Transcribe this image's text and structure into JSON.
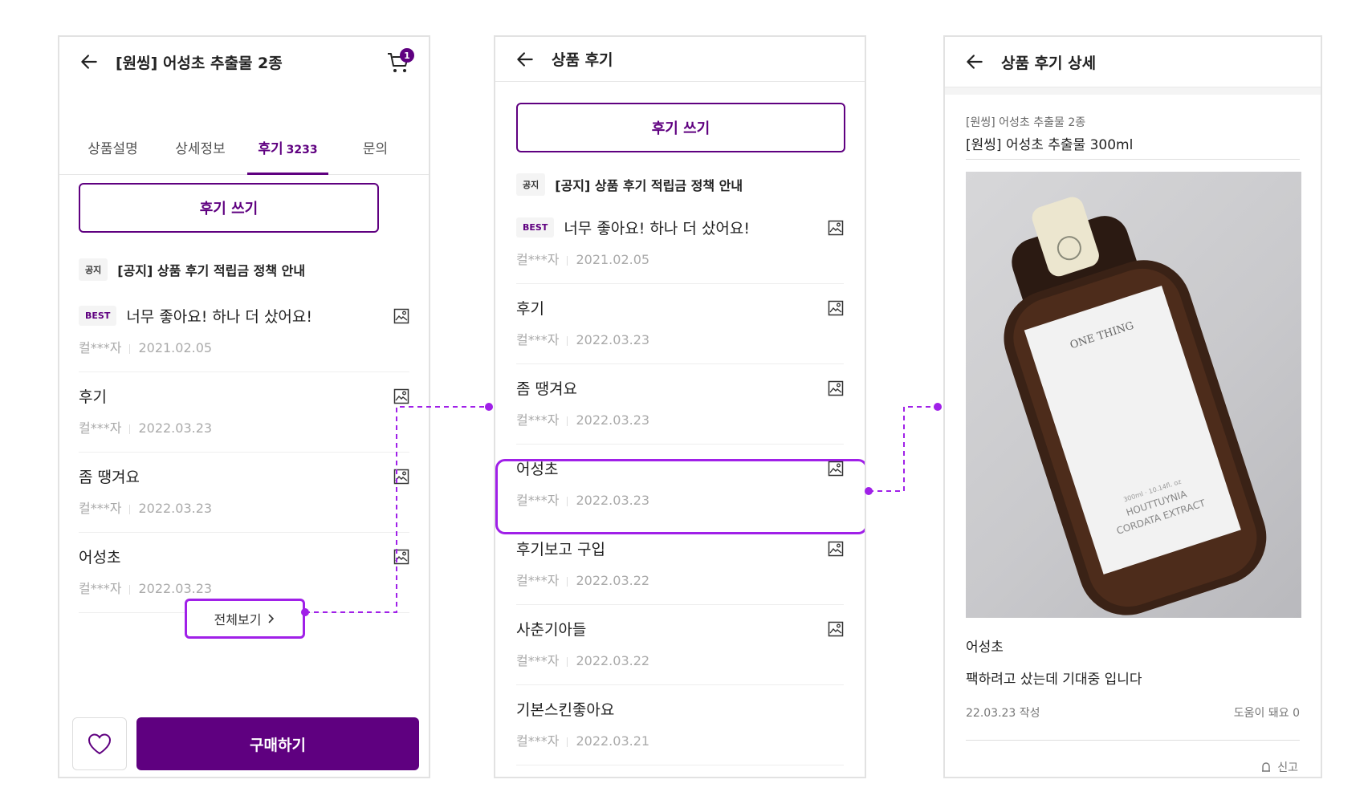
{
  "colors": {
    "brand": "#5f0080",
    "highlight": "#a020e8"
  },
  "screen1": {
    "title": "[원씽] 어성초 추출물 2종",
    "cart_count": "1",
    "tabs": [
      {
        "label": "상품설명",
        "count": ""
      },
      {
        "label": "상세정보",
        "count": ""
      },
      {
        "label": "후기",
        "count": "3233"
      },
      {
        "label": "문의",
        "count": ""
      }
    ],
    "write_label": "후기 쓰기",
    "notice_badge": "공지",
    "notice_text": "[공지] 상품 후기 적립금 정책 안내",
    "best_badge": "BEST",
    "reviews": [
      {
        "title": "너무 좋아요! 하나 더 샀어요!",
        "author": "컬***자",
        "date": "2021.02.05"
      },
      {
        "title": "후기",
        "author": "컬***자",
        "date": "2022.03.23"
      },
      {
        "title": "좀 땡겨요",
        "author": "컬***자",
        "date": "2022.03.23"
      },
      {
        "title": "어성초",
        "author": "컬***자",
        "date": "2022.03.23"
      }
    ],
    "view_all": "전체보기",
    "buy_label": "구매하기",
    "icons": {
      "back": "arrow-left-icon",
      "cart": "cart-icon",
      "heart": "heart-icon",
      "photo": "image-icon",
      "chevron": "chevron-right-icon"
    }
  },
  "screen2": {
    "title": "상품 후기",
    "write_label": "후기 쓰기",
    "notice_badge": "공지",
    "notice_text": "[공지] 상품 후기 적립금 정책 안내",
    "best_badge": "BEST",
    "reviews": [
      {
        "title": "너무 좋아요! 하나 더 샀어요!",
        "author": "컬***자",
        "date": "2021.02.05"
      },
      {
        "title": "후기",
        "author": "컬***자",
        "date": "2022.03.23"
      },
      {
        "title": "좀 땡겨요",
        "author": "컬***자",
        "date": "2022.03.23"
      },
      {
        "title": "어성초",
        "author": "컬***자",
        "date": "2022.03.23"
      },
      {
        "title": "후기보고 구입",
        "author": "컬***자",
        "date": "2022.03.22"
      },
      {
        "title": "사춘기아들",
        "author": "컬***자",
        "date": "2022.03.22"
      },
      {
        "title": "기본스킨좋아요",
        "author": "컬***자",
        "date": "2022.03.21"
      }
    ]
  },
  "screen3": {
    "title": "상품 후기 상세",
    "product_name": "[원씽] 어성초 추출물 2종",
    "option_name": "[원씽] 어성초 추출물 300ml",
    "photo_label_brand": "ONE THING",
    "photo_label_line1": "300ml · 10.14fl. oz",
    "photo_label_line2": "HOUTTUYNIA",
    "photo_label_line3": "CORDATA EXTRACT",
    "review_title": "어성초",
    "review_body": "팩하려고 샀는데 기대중 입니다",
    "review_date": "22.03.23 작성",
    "helpful": "도움이 돼요 0",
    "report": "신고"
  }
}
